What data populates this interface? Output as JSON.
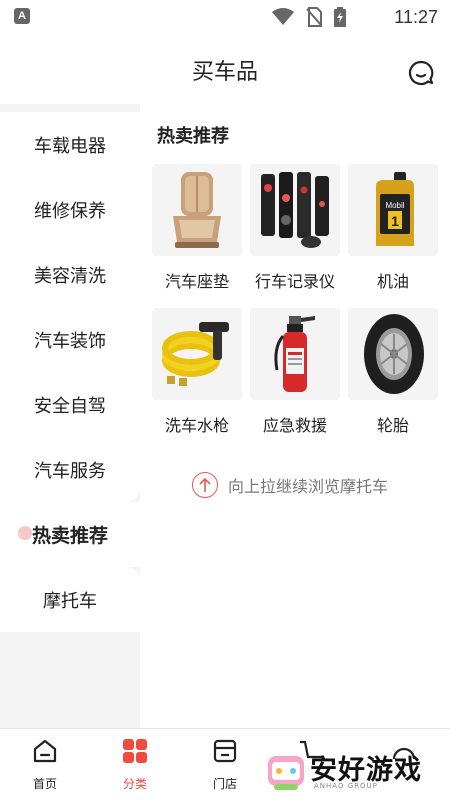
{
  "status_bar": {
    "time": "11:27",
    "notification_icon": "A"
  },
  "header": {
    "title": "买车品",
    "message_icon": "chat-bubble-icon"
  },
  "sidebar": {
    "items": [
      {
        "label": "车载电器"
      },
      {
        "label": "维修保养"
      },
      {
        "label": "美容清洗"
      },
      {
        "label": "汽车装饰"
      },
      {
        "label": "安全自驾"
      },
      {
        "label": "汽车服务"
      },
      {
        "label": "热卖推荐",
        "active": true
      },
      {
        "label": "摩托车"
      }
    ]
  },
  "content": {
    "section_title": "热卖推荐",
    "products": [
      {
        "label": "汽车座垫",
        "icon": "car-seat-cushion-image"
      },
      {
        "label": "行车记录仪",
        "icon": "dashcam-image"
      },
      {
        "label": "机油",
        "icon": "motor-oil-image"
      },
      {
        "label": "洗车水枪",
        "icon": "car-wash-hose-image"
      },
      {
        "label": "应急救援",
        "icon": "fire-extinguisher-image"
      },
      {
        "label": "轮胎",
        "icon": "tire-image"
      }
    ],
    "pull_hint": "向上拉继续浏览摩托车"
  },
  "tabbar": {
    "tabs": [
      {
        "label": "首页",
        "icon": "home-icon"
      },
      {
        "label": "分类",
        "icon": "category-grid-icon",
        "active": true
      },
      {
        "label": "门店",
        "icon": "store-icon"
      }
    ]
  },
  "watermark": {
    "text": "安好游戏",
    "subtext": "ANHAO GROUP"
  },
  "colors": {
    "accent": "#f04b3c",
    "sidebar_bg": "#f4f4f4",
    "hint_red": "#e35c52"
  }
}
